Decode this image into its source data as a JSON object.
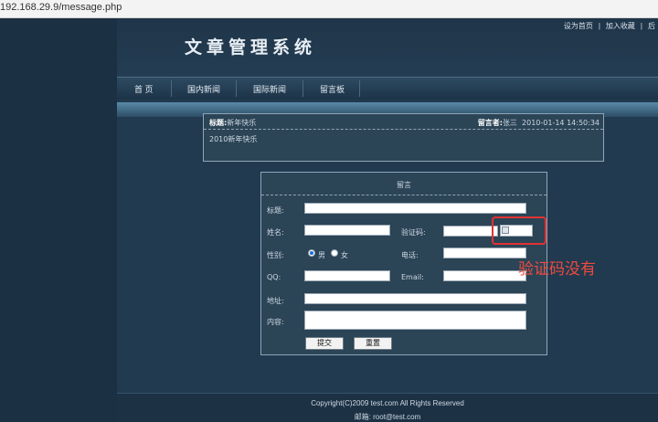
{
  "browser": {
    "url": "192.168.29.9/message.php"
  },
  "header": {
    "site_title": "文章管理系统",
    "links": [
      "设为首页",
      "|",
      "加入收藏",
      "|",
      "后"
    ]
  },
  "nav": {
    "items": [
      "首 页",
      "国内新闻",
      "国际新闻",
      "留言板"
    ]
  },
  "message": {
    "title_label": "标题:",
    "title_value": "新年快乐",
    "author_label": "留言者:",
    "author_value": "张三",
    "datetime": "2010-01-14 14:50:34",
    "body": "2010新年快乐"
  },
  "form": {
    "heading": "留言",
    "labels": {
      "title": "标题:",
      "name": "姓名:",
      "captcha": "验证码:",
      "gender": "性别:",
      "male": "男",
      "female": "女",
      "phone": "电话:",
      "qq": "QQ:",
      "email": "Email:",
      "address": "地址:",
      "content": "内容:"
    },
    "gender_selected": "男",
    "submit_label": "提交",
    "reset_label": "重置"
  },
  "footer": {
    "copyright": "Copyright(C)2009 test.com All Rights Reserved",
    "email": "邮箱: root@test.com"
  },
  "annotation": {
    "text": "验证码没有",
    "color": "#f04a3d"
  },
  "colors": {
    "page_bg": "#1b3043",
    "panel_bg": "#2b4456",
    "highlight": "#e23232"
  }
}
